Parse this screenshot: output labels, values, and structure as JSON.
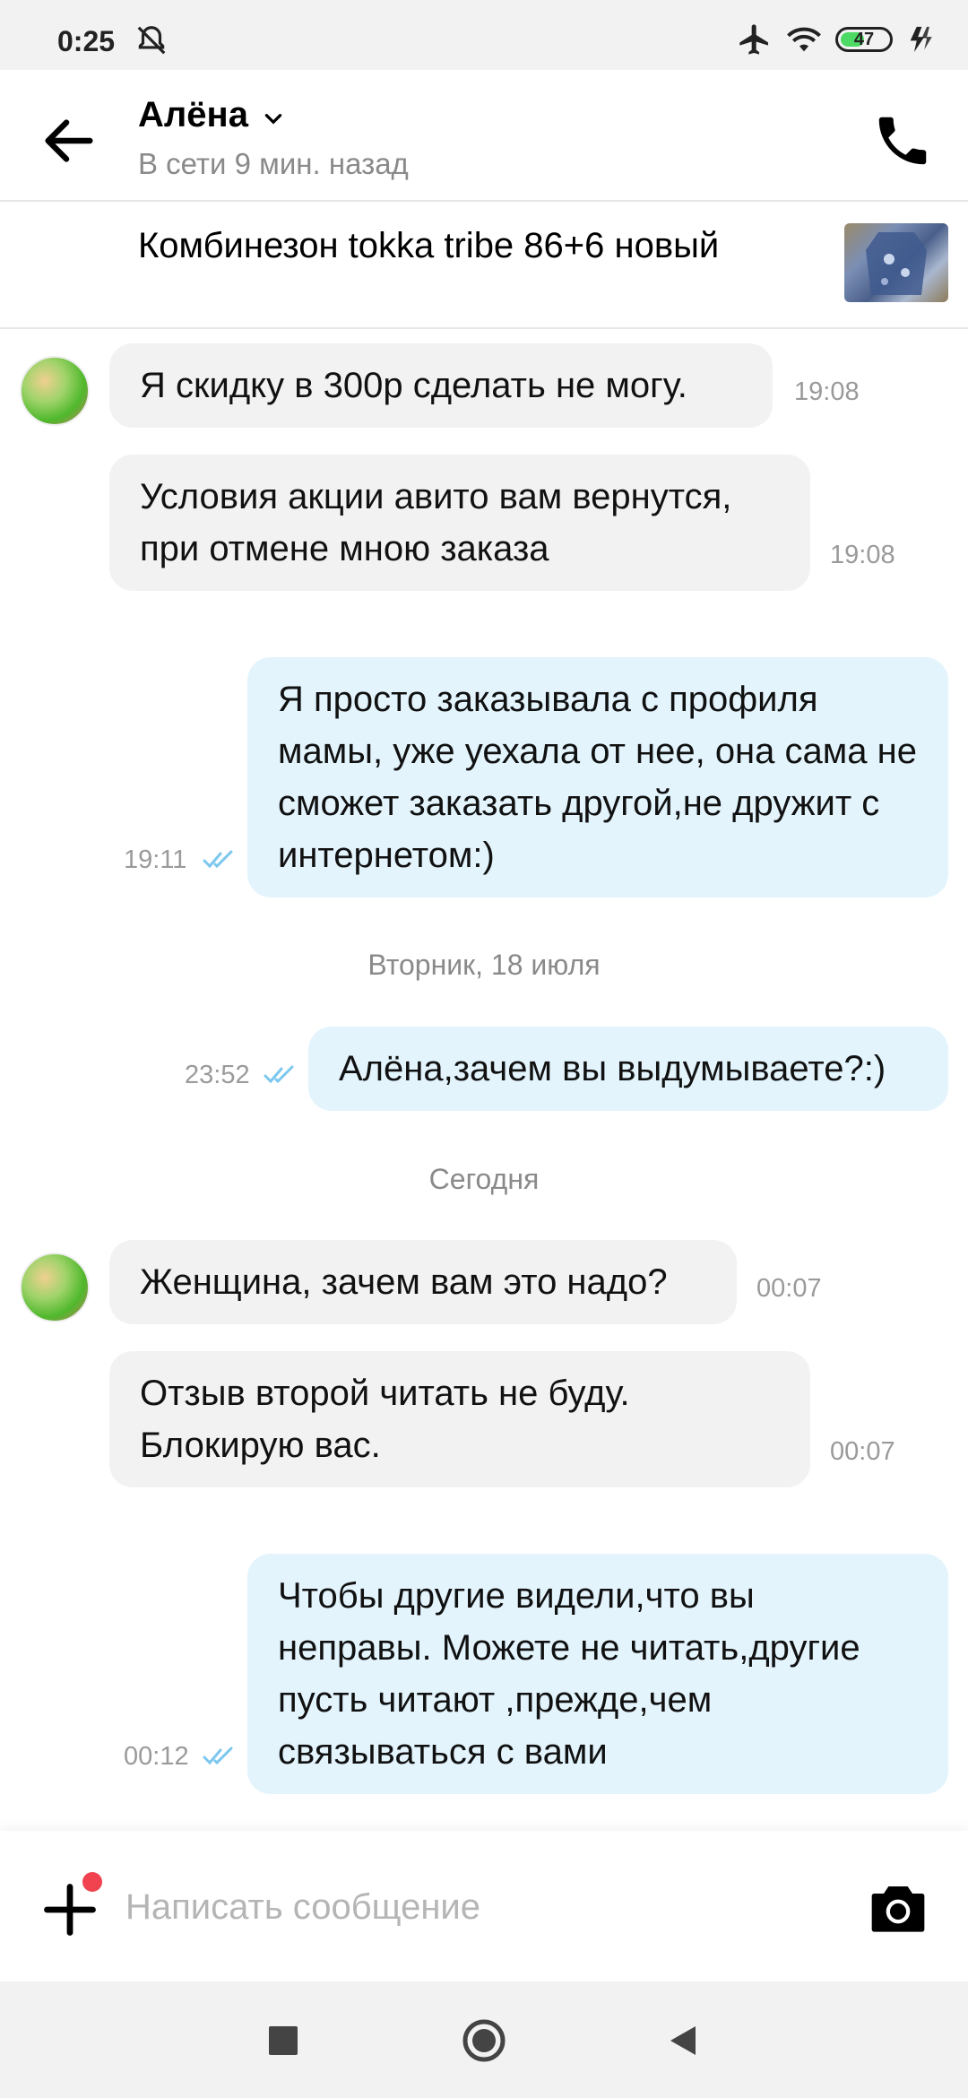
{
  "status_bar": {
    "time": "0:25",
    "battery": "47"
  },
  "header": {
    "name": "Алёна",
    "status": "В сети 9 мин. назад"
  },
  "product": {
    "title": "Комбинезон tokka tribe 86+6 новый"
  },
  "messages": [
    {
      "direction": "in",
      "text": "Я скидку в 300р сделать не могу.",
      "time": "19:08"
    },
    {
      "direction": "in",
      "text": "Условия акции авито вам вернутся, при отмене мною заказа",
      "time": "19:08"
    },
    {
      "direction": "out",
      "text": "Я просто заказывала с профиля мамы, уже уехала от нее, она сама не сможет заказать другой,не дружит с интернетом:)",
      "time": "19:11",
      "read": true
    },
    {
      "direction": "out",
      "text": "Алёна,зачем вы выдумываете?:)",
      "time": "23:52",
      "read": true
    },
    {
      "direction": "in",
      "text": "Женщина, зачем вам это надо?",
      "time": "00:07"
    },
    {
      "direction": "in",
      "text": "Отзыв второй читать не буду. Блокирую вас.",
      "time": "00:07"
    },
    {
      "direction": "out",
      "text": "Чтобы другие видели,что вы неправы. Можете не читать,другие пусть читают ,прежде,чем связываться с вами",
      "time": "00:12",
      "read": true
    }
  ],
  "day_separators": [
    "Вторник, 18 июля",
    "Сегодня"
  ],
  "composer": {
    "placeholder": "Написать сообщение"
  },
  "icons": {
    "back": "arrow-left-icon",
    "call": "phone-icon",
    "add": "plus-icon",
    "camera": "camera-icon",
    "read": "double-check-icon"
  },
  "colors": {
    "incoming_bubble": "#f2f2f2",
    "outgoing_bubble": "#e3f4fd",
    "read_ticks": "#7cc7ee",
    "notification_dot": "#f0434f"
  }
}
